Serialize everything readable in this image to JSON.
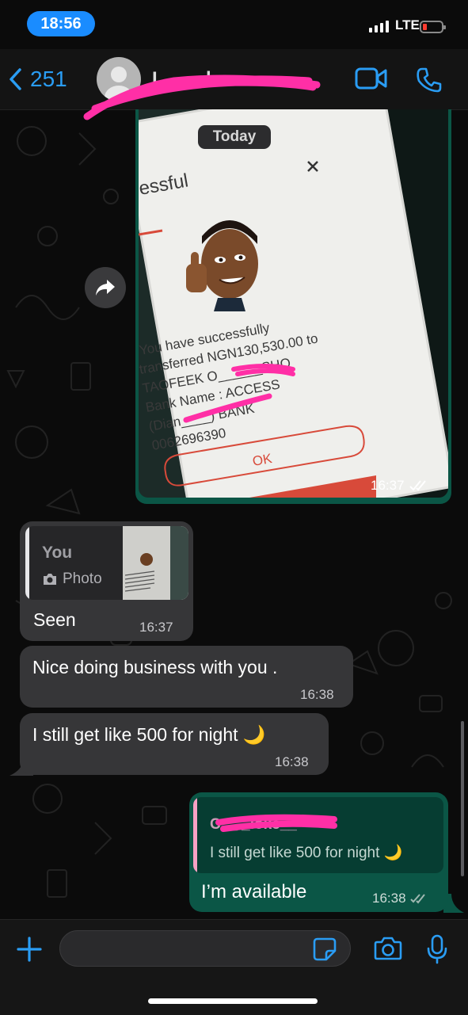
{
  "status_bar": {
    "time": "18:56",
    "network": "LTE"
  },
  "header": {
    "back_count": "251",
    "contact_name": "L____l"
  },
  "date_chip": "Today",
  "image_message": {
    "receipt_heading": "essful",
    "receipt_lines": [
      "You have successfully",
      "transferred NGN130,530.00 to",
      "TAOFEEK O______SHO",
      "Bank Name : ACCESS",
      "(Dian____) BANK",
      "0062696390"
    ],
    "ok_label": "OK",
    "time": "16:37"
  },
  "messages": [
    {
      "quote_author": "You",
      "quote_type": "Photo",
      "text": "Seen",
      "time": "16:37"
    },
    {
      "text": "Nice doing business with you .",
      "time": "16:38"
    },
    {
      "text": "I still get like 500 for night 🌙",
      "time": "16:38"
    }
  ],
  "outgoing": {
    "quote_author": "C__ _loke__",
    "quote_text": "I still get like 500 for night 🌙",
    "text": "I’m available",
    "time": "16:38"
  }
}
